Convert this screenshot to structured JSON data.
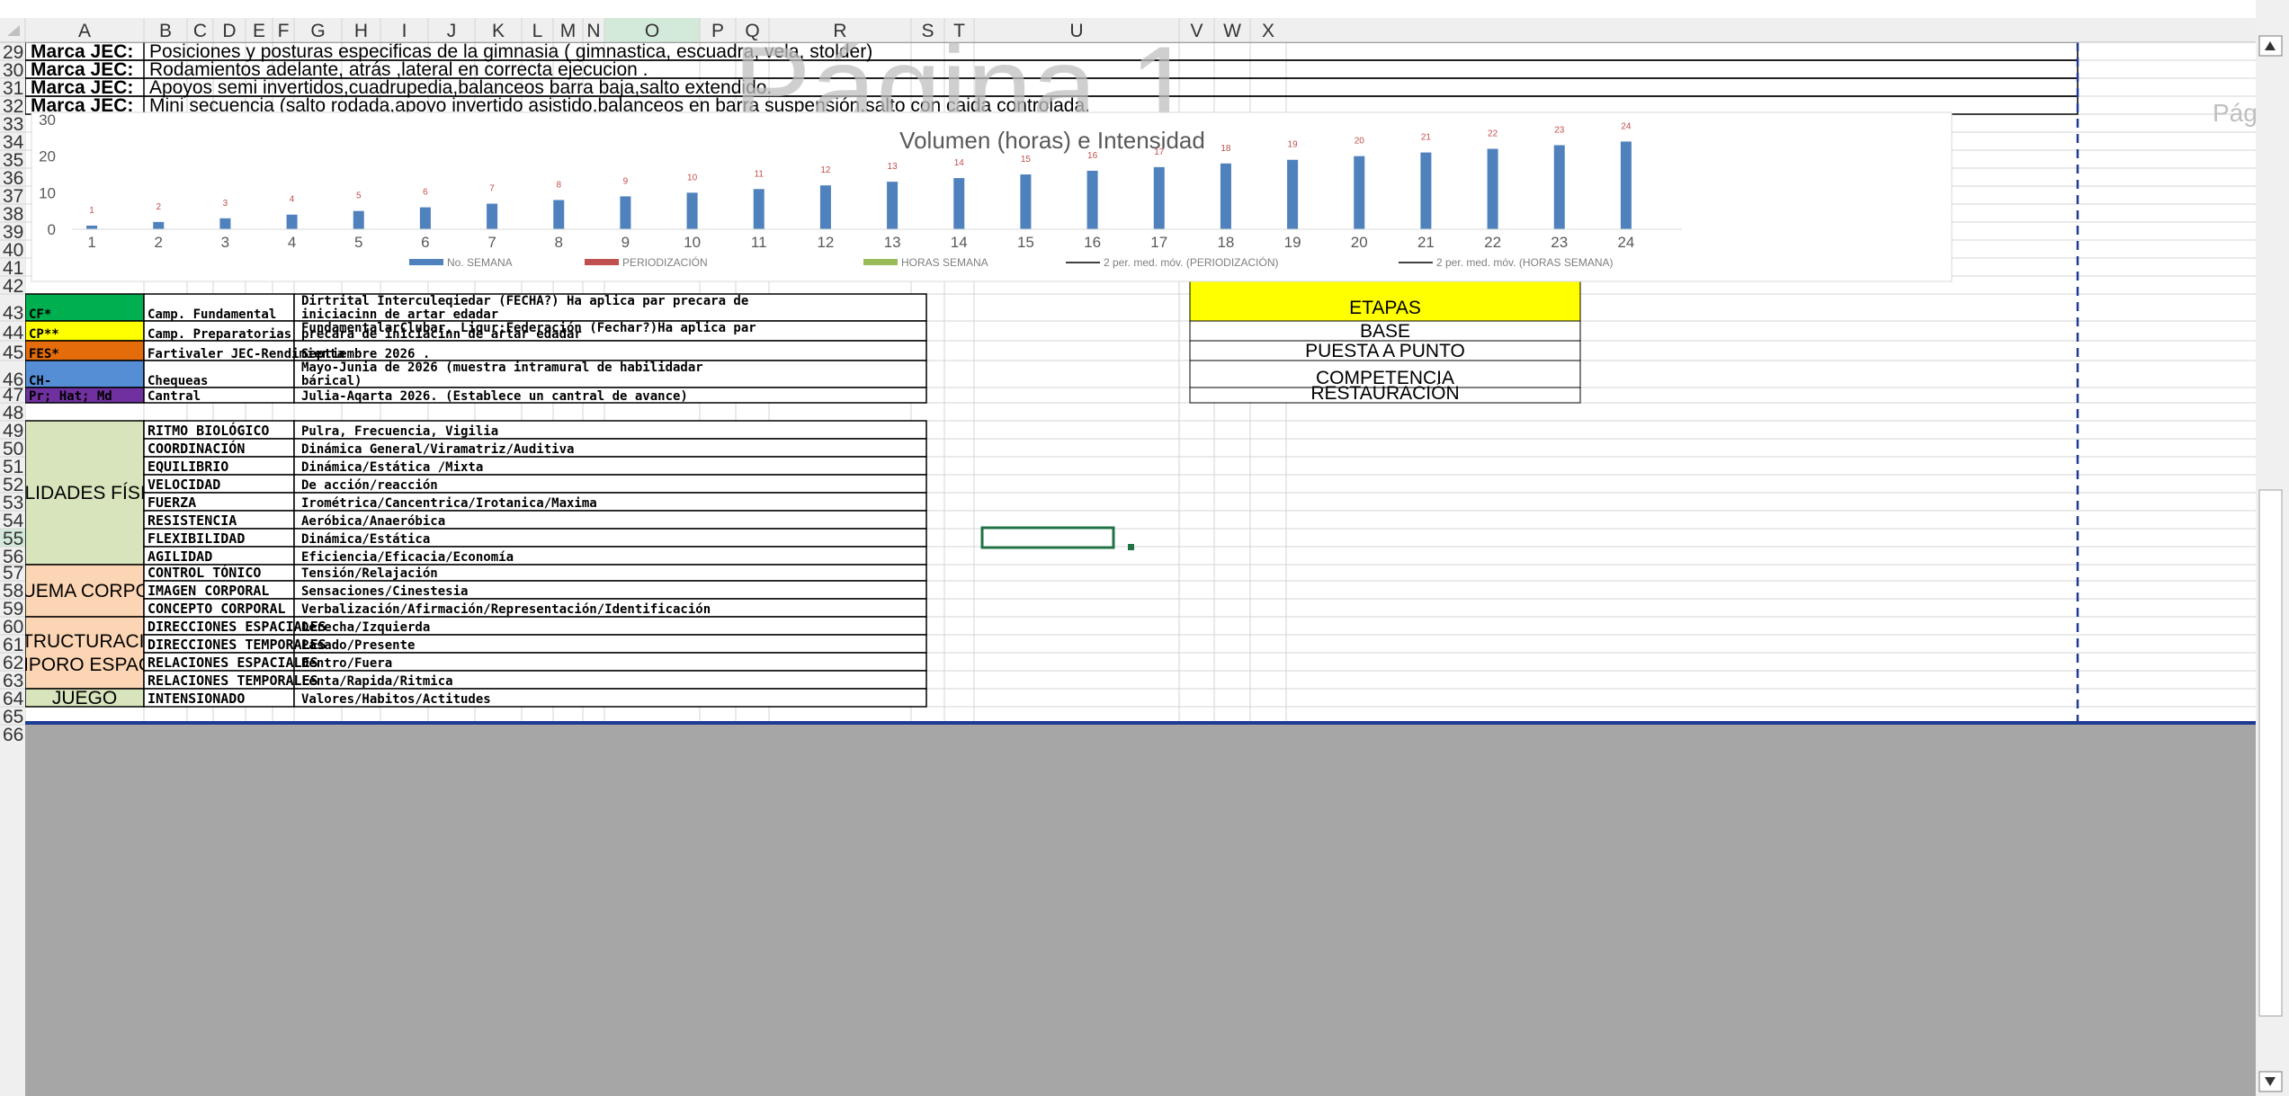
{
  "columns": [
    "A",
    "B",
    "C",
    "D",
    "E",
    "F",
    "G",
    "H",
    "I",
    "J",
    "K",
    "L",
    "M",
    "N",
    "O",
    "P",
    "Q",
    "R",
    "S",
    "T",
    "U",
    "V",
    "W",
    "X"
  ],
  "rows": [
    "29",
    "30",
    "31",
    "32",
    "33",
    "34",
    "35",
    "36",
    "37",
    "38",
    "39",
    "40",
    "41",
    "42",
    "43",
    "44",
    "45",
    "46",
    "47",
    "48",
    "49",
    "50",
    "51",
    "52",
    "53",
    "54",
    "55",
    "56",
    "57",
    "58",
    "59",
    "60",
    "61",
    "62",
    "63",
    "64",
    "65",
    "66"
  ],
  "watermark": "Página 1",
  "page_label_right": "Pág",
  "marca_rows": [
    {
      "label": "Marca JEC:",
      "text": "Posiciones y posturas especificas de la gimnasia ( gimnastica, escuadra, vela, stolder)"
    },
    {
      "label": "Marca JEC:",
      "text": "Rodamientos adelante, atrás ,lateral en correcta ejecucion ."
    },
    {
      "label": "Marca JEC:",
      "text": "Apoyos semi invertidos,cuadrupedia,balanceos barra baja,salto extendido."
    },
    {
      "label": "Marca JEC:",
      "text": "Mini secuencia (salto rodada,apoyo invertido asistido,balanceos en barra suspensión,salto con caida controlada."
    }
  ],
  "legend_rows": [
    {
      "code": "CF*",
      "color": "#00b050",
      "name": "Camp. Fundamental",
      "desc": [
        "Dirtrital Interculeqiedar (FECHA?) Ha aplica par precara de",
        "iniciacinn de artar edadar"
      ]
    },
    {
      "code": "CP**",
      "color": "#ffff00",
      "name": "Camp. Preparatorias",
      "desc": [
        "FundamentalarClubar, Liqur;Federación (Fechar?)Ha aplica par",
        "precara de iniciacinn de artar edadar"
      ]
    },
    {
      "code": "FES*",
      "color": "#e46c0a",
      "name": "Fartivaler JEC-Rendimienta",
      "desc": [
        "Septiembre 2026 ."
      ]
    },
    {
      "code": "CH-",
      "color": "#558ed5",
      "name": "Chequeas",
      "desc": [
        "Mayo-Junia de 2026 (muestra intramural de habilidadar",
        "bárical)"
      ]
    },
    {
      "code": "Pr; Hat; Md",
      "color": "#7030a0",
      "name": "Cantral",
      "desc": [
        "Julia-Aqarta 2026. (Establece un cantral de avance)"
      ]
    }
  ],
  "etapas": {
    "header": "ETAPAS",
    "items": [
      "BASE",
      "PUESTA A PUNTO",
      "COMPETENCIA",
      "RESTAURACIÓN"
    ]
  },
  "qualities": [
    {
      "group": "CUALIDADES FÍSICAS",
      "color": "#d8e4bc",
      "items": [
        {
          "name": "RITMO BIOLÓGICO",
          "desc": "Pulra, Frecuencia, Vigilia"
        },
        {
          "name": "COORDINACIÓN",
          "desc": "Dinámica General/Viramatriz/Auditiva"
        },
        {
          "name": "EQUILIBRIO",
          "desc": "Dinámica/Estática /Mixta"
        },
        {
          "name": "VELOCIDAD",
          "desc": "De acción/reacción"
        },
        {
          "name": "FUERZA",
          "desc": "Irométrica/Cancentrica/Irotanica/Maxima"
        },
        {
          "name": "RESISTENCIA",
          "desc": "Aeróbica/Anaeróbica"
        },
        {
          "name": "FLEXIBILIDAD",
          "desc": "Dinámica/Estática"
        },
        {
          "name": "AGILIDAD",
          "desc": "Eficiencia/Eficacia/Economía"
        }
      ]
    },
    {
      "group": "ESQUEMA CORPORAL",
      "color": "#fcd5b4",
      "items": [
        {
          "name": "CONTROL TÓNICO",
          "desc": "Tensión/Relajación"
        },
        {
          "name": "IMAGEN CORPORAL",
          "desc": "Sensaciones/Cinestesia"
        },
        {
          "name": "CONCEPTO CORPORAL",
          "desc": "Verbalización/Afirmación/Representación/Identificación"
        }
      ]
    },
    {
      "group": "ESTRUCTURACIÓN TEMPORO ESPACIAL",
      "group_lines": [
        "ESTRUCTURACIÓN",
        "TEMPORO ESPACIAL"
      ],
      "color": "#fcd5b4",
      "items": [
        {
          "name": "DIRECCIONES ESPACIALES",
          "desc": "Derecha/Izquierda"
        },
        {
          "name": "DIRECCIONES TEMPORALES",
          "desc": "Pasado/Presente"
        },
        {
          "name": "RELACIONES ESPACIALES",
          "desc": "Dentro/Fuera"
        },
        {
          "name": "RELACIONES TEMPORALES",
          "desc": "Lenta/Rapida/Ritmica"
        }
      ]
    },
    {
      "group": "JUEGO",
      "color": "#d8e4bc",
      "items": [
        {
          "name": "INTENSIONADO",
          "desc": "Valores/Habitos/Actitudes"
        }
      ]
    }
  ],
  "chart_data": {
    "type": "bar",
    "title": "Volumen (horas) e Intensidad",
    "categories": [
      "1",
      "2",
      "3",
      "4",
      "5",
      "6",
      "7",
      "8",
      "9",
      "10",
      "11",
      "12",
      "13",
      "14",
      "15",
      "16",
      "17",
      "18",
      "19",
      "20",
      "21",
      "22",
      "23",
      "24"
    ],
    "series": [
      {
        "name": "No. SEMANA",
        "color": "#4f81bd",
        "values": [
          1,
          2,
          3,
          4,
          5,
          6,
          7,
          8,
          9,
          10,
          11,
          12,
          13,
          14,
          15,
          16,
          17,
          18,
          19,
          20,
          21,
          22,
          23,
          24
        ]
      }
    ],
    "data_labels": [
      "1",
      "2",
      "3",
      "4",
      "5",
      "6",
      "7",
      "8",
      "9",
      "10",
      "11",
      "12",
      "13",
      "14",
      "15",
      "16",
      "17",
      "18",
      "19",
      "20",
      "21",
      "22",
      "23",
      "24"
    ],
    "yticks": [
      "0",
      "10",
      "20",
      "30"
    ],
    "ylim": [
      0,
      30
    ],
    "legend": [
      {
        "label": "No. SEMANA",
        "color": "#4f81bd",
        "kind": "bar"
      },
      {
        "label": "PERIODIZACIÓN",
        "color": "#c0504d",
        "kind": "bar"
      },
      {
        "label": "HORAS SEMANA",
        "color": "#9bbb59",
        "kind": "bar"
      },
      {
        "label": "2 per. med. móv. (PERIODIZACIÓN)",
        "color": "#000000",
        "kind": "line"
      },
      {
        "label": "2 per. med. móv. (HORAS SEMANA)",
        "color": "#000000",
        "kind": "line"
      }
    ],
    "legend_position": "bottom"
  }
}
